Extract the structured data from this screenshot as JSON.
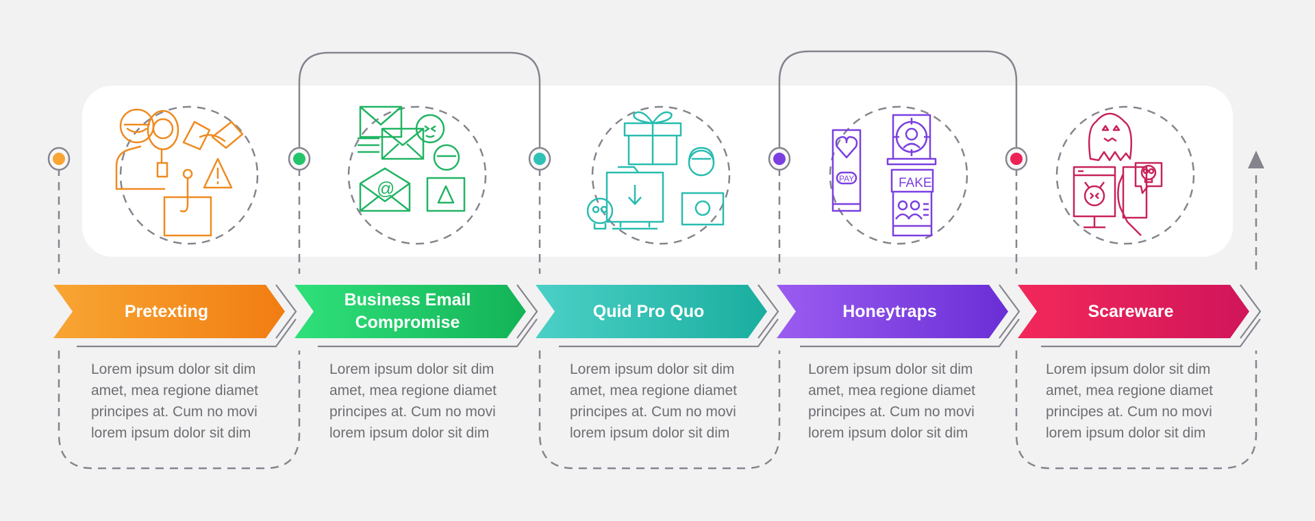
{
  "diagram": {
    "steps": [
      {
        "title": "Pretexting",
        "title_lines": [
          "Pretexting"
        ],
        "color_start": "#f8a533",
        "color_end": "#f27d12",
        "icon": "pretexting-icon",
        "description": [
          "Lorem ipsum dolor sit dim",
          "amet, mea regione diamet",
          "principes at. Cum no movi",
          "lorem ipsum dolor sit dim"
        ]
      },
      {
        "title": "Business Email Compromise",
        "title_lines": [
          "Business Email",
          "Compromise"
        ],
        "color_start": "#2fe07a",
        "color_end": "#13b357",
        "icon": "business-email-compromise-icon",
        "description": [
          "Lorem ipsum dolor sit dim",
          "amet, mea regione diamet",
          "principes at. Cum no movi",
          "lorem ipsum dolor sit dim"
        ]
      },
      {
        "title": "Quid Pro Quo",
        "title_lines": [
          "Quid Pro Quo"
        ],
        "color_start": "#4bd0c6",
        "color_end": "#1aae9f",
        "icon": "quid-pro-quo-icon",
        "description": [
          "Lorem ipsum dolor sit dim",
          "amet, mea regione diamet",
          "principes at. Cum no movi",
          "lorem ipsum dolor sit dim"
        ]
      },
      {
        "title": "Honeytraps",
        "title_lines": [
          "Honeytraps"
        ],
        "color_start": "#9a5cf0",
        "color_end": "#6a2ed6",
        "icon": "honeytraps-icon",
        "description": [
          "Lorem ipsum dolor sit dim",
          "amet, mea regione diamet",
          "principes at. Cum no movi",
          "lorem ipsum dolor sit dim"
        ]
      },
      {
        "title": "Scareware",
        "title_lines": [
          "Scareware"
        ],
        "color_start": "#f2285a",
        "color_end": "#d0155a",
        "icon": "scareware-icon",
        "description": [
          "Lorem ipsum dolor sit dim",
          "amet, mea regione diamet",
          "principes at. Cum no movi",
          "lorem ipsum dolor sit dim"
        ]
      }
    ],
    "node_colors": [
      "#f8a533",
      "#25c46a",
      "#2fc1b6",
      "#7b3fe0",
      "#ec2256"
    ],
    "icon_colors": [
      "#ef8a1f",
      "#20b463",
      "#28bcb0",
      "#7a3fe0",
      "#c7225b"
    ],
    "connector_color": "#85848d",
    "arrow_icon": "arrow-up-icon"
  }
}
